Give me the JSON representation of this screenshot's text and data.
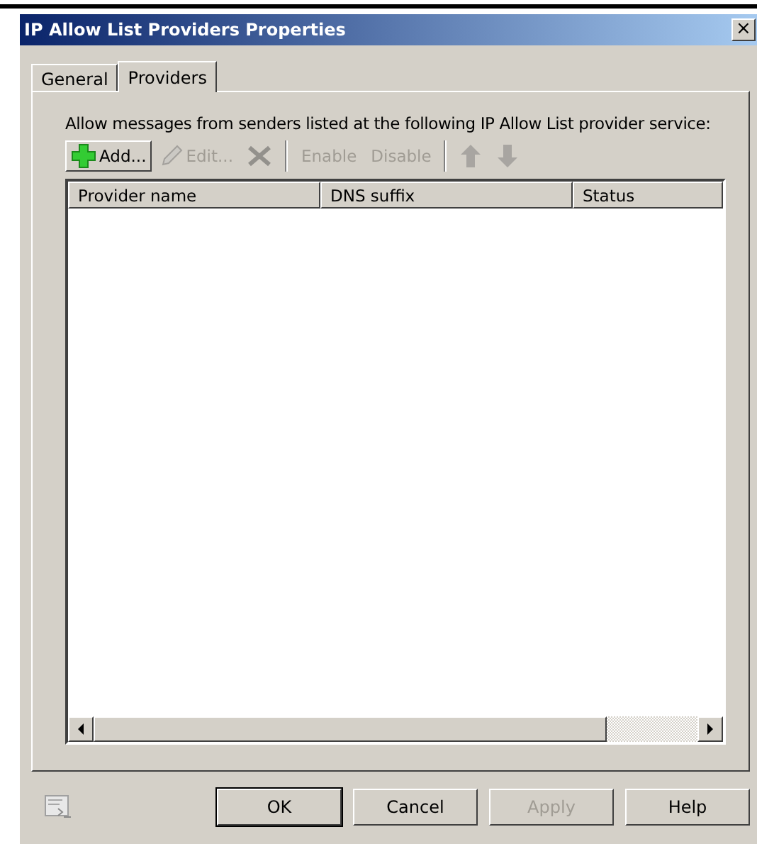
{
  "window": {
    "title": "IP Allow List Providers Properties",
    "close": "×"
  },
  "tabs": [
    {
      "label": "General",
      "selected": false
    },
    {
      "label": "Providers",
      "selected": true
    }
  ],
  "description": "Allow messages from senders listed at the following IP Allow List provider service:",
  "toolbar": [
    {
      "kind": "add",
      "label": "Add...",
      "disabled": false
    },
    {
      "kind": "edit",
      "label": "Edit...",
      "disabled": true
    },
    {
      "kind": "delete",
      "disabled": true
    },
    {
      "kind": "separator"
    },
    {
      "kind": "text",
      "label": "Enable",
      "disabled": true
    },
    {
      "kind": "text",
      "label": "Disable",
      "disabled": true
    },
    {
      "kind": "separator"
    },
    {
      "kind": "up",
      "disabled": true
    },
    {
      "kind": "down",
      "disabled": true
    }
  ],
  "table": {
    "columns": [
      "Provider name",
      "DNS suffix",
      "Status"
    ]
  },
  "buttons": [
    {
      "label": "OK",
      "default": true,
      "disabled": false
    },
    {
      "label": "Cancel",
      "default": false,
      "disabled": false
    },
    {
      "label": "Apply",
      "default": false,
      "disabled": true
    },
    {
      "label": "Help",
      "default": false,
      "disabled": false
    }
  ]
}
